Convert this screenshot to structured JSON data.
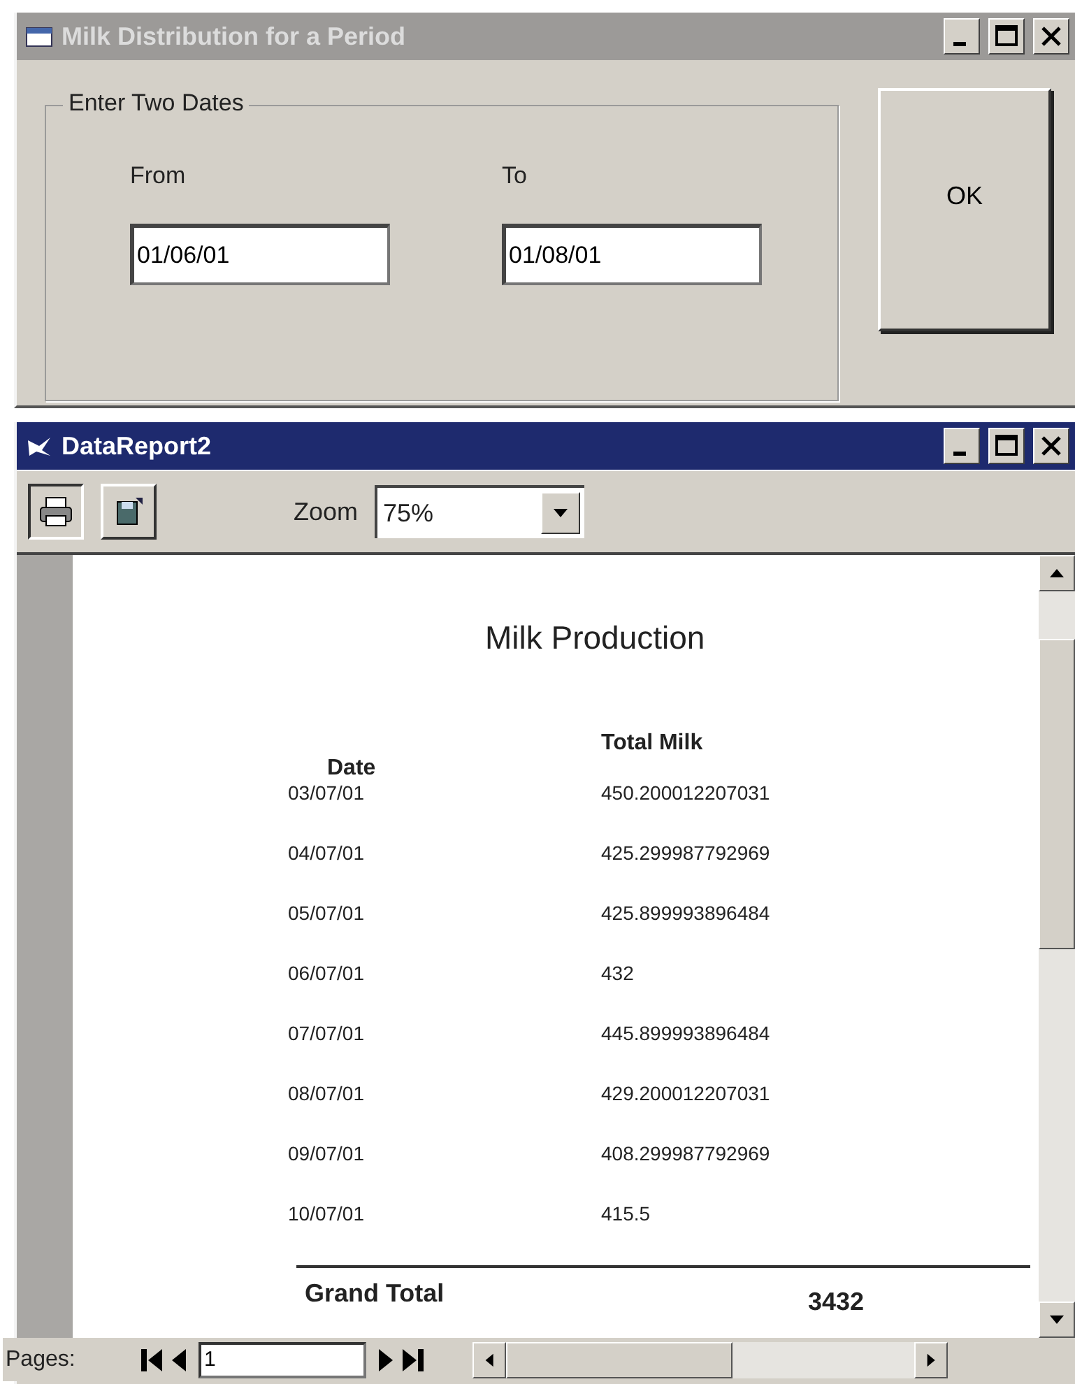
{
  "dialog": {
    "title": "Milk Distribution for a Period",
    "active": false,
    "group_label": "Enter Two Dates",
    "fields": [
      {
        "label": "From",
        "value": "01/06/01"
      },
      {
        "label": "To",
        "value": "01/08/01"
      }
    ],
    "ok_button": "OK"
  },
  "report_window": {
    "title": "DataReport2",
    "active": true,
    "zoom_label": "Zoom",
    "zoom_value": "75%"
  },
  "report": {
    "title": "Milk Production",
    "columns": [
      "Date",
      "Total Milk"
    ],
    "rows": [
      [
        "03/07/01",
        "450.200012207031"
      ],
      [
        "04/07/01",
        "425.299987792969"
      ],
      [
        "05/07/01",
        "425.899993896484"
      ],
      [
        "06/07/01",
        "432"
      ],
      [
        "07/07/01",
        "445.899993896484"
      ],
      [
        "08/07/01",
        "429.200012207031"
      ],
      [
        "09/07/01",
        "408.299987792969"
      ],
      [
        "10/07/01",
        "415.5"
      ]
    ],
    "total_label": "Grand Total",
    "total_value": "3432"
  },
  "pager": {
    "label": "Pages:",
    "page": "1"
  }
}
